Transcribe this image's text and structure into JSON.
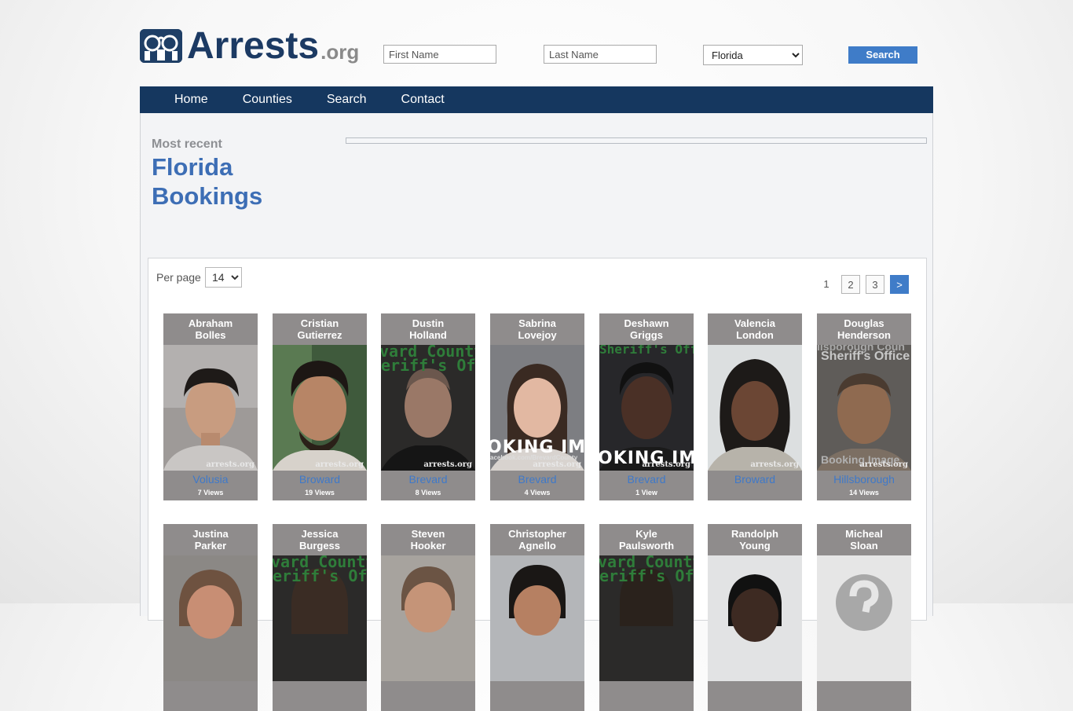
{
  "site": {
    "name": "Arrests",
    "tld": ".org"
  },
  "search": {
    "first_placeholder": "First Name",
    "last_placeholder": "Last Name",
    "state_value": "Florida",
    "button": "Search"
  },
  "nav": [
    {
      "label": "Home"
    },
    {
      "label": "Counties"
    },
    {
      "label": "Search"
    },
    {
      "label": "Contact"
    }
  ],
  "page": {
    "kicker": "Most recent",
    "title_line1": "Florida",
    "title_line2": "Bookings"
  },
  "listing": {
    "per_page_label": "Per page",
    "per_page_value": "14"
  },
  "pagination": {
    "current": "1",
    "pages": [
      "2",
      "3"
    ],
    "next": ">"
  },
  "watermark": "arrests.org",
  "overlays": {
    "sheriff": "Sheriff's Office",
    "county_office": "vard County",
    "sheriff_short": "eriff's Offi",
    "booking": "OKING IMA",
    "booking2": "OKING IM",
    "booking_image": "Booking Image",
    "hills": "llsborough Coun",
    "facebook": "acebook.com/BrevardCounty"
  },
  "bookings": [
    {
      "first": "Abraham",
      "last": "Bolles",
      "county": "Volusia",
      "views": "7 Views"
    },
    {
      "first": "Cristian",
      "last": "Gutierrez",
      "county": "Broward",
      "views": "19 Views"
    },
    {
      "first": "Dustin",
      "last": "Holland",
      "county": "Brevard",
      "views": "8 Views"
    },
    {
      "first": "Sabrina",
      "last": "Lovejoy",
      "county": "Brevard",
      "views": "4 Views"
    },
    {
      "first": "Deshawn",
      "last": "Griggs",
      "county": "Brevard",
      "views": "1 View"
    },
    {
      "first": "Valencia",
      "last": "London",
      "county": "Broward",
      "views": ""
    },
    {
      "first": "Douglas",
      "last": "Henderson",
      "county": "Hillsborough",
      "views": "14 Views"
    },
    {
      "first": "Justina",
      "last": "Parker"
    },
    {
      "first": "Jessica",
      "last": "Burgess"
    },
    {
      "first": "Steven",
      "last": "Hooker"
    },
    {
      "first": "Christopher",
      "last": "Agnello"
    },
    {
      "first": "Kyle",
      "last": "Paulsworth"
    },
    {
      "first": "Randolph",
      "last": "Young"
    },
    {
      "first": "Micheal",
      "last": "Sloan"
    }
  ],
  "colors": {
    "nav": "#15375f",
    "accent": "#3f7cc8",
    "title": "#3d6eb5",
    "card": "#8f8c8c",
    "county_link": "#3f79c9"
  }
}
